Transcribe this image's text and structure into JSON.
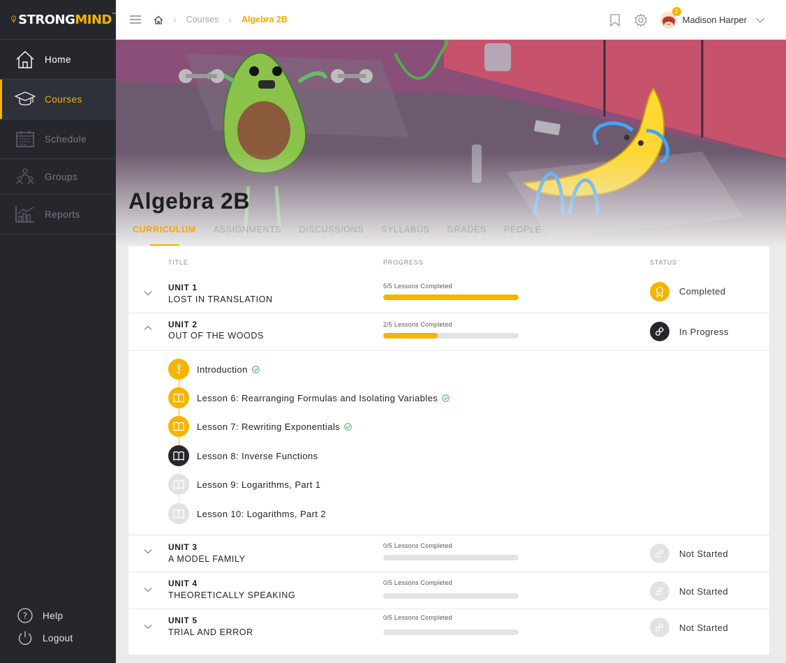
{
  "brand": {
    "strong": "STRONG",
    "mind": "MIND",
    "tm": "™"
  },
  "sidebar": {
    "items": [
      {
        "label": "Home",
        "icon": "home-icon"
      },
      {
        "label": "Courses",
        "icon": "graduation-cap-icon"
      },
      {
        "label": "Schedule",
        "icon": "calendar-icon"
      },
      {
        "label": "Groups",
        "icon": "groups-icon"
      },
      {
        "label": "Reports",
        "icon": "reports-icon"
      }
    ],
    "help": "Help",
    "logout": "Logout"
  },
  "breadcrumb": {
    "courses": "Courses",
    "current": "Algebra 2B"
  },
  "user": {
    "name": "Madison Harper",
    "notifications": "2"
  },
  "course": {
    "title": "Algebra 2B"
  },
  "tabs": [
    "CURRICULUM",
    "ASSIGNMENTS",
    "DISCUSSIONS",
    "SYLLABUS",
    "GRADES",
    "PEOPLE"
  ],
  "columns": {
    "title": "TITLE",
    "progress": "PROGRESS",
    "status": "STATUS"
  },
  "units": [
    {
      "number": "UNIT 1",
      "name": "LOST IN TRANSLATION",
      "progress_text": "5/5 Lessons Completed",
      "progress": 1.0,
      "status": "Completed",
      "expanded": false
    },
    {
      "number": "UNIT 2",
      "name": "OUT OF THE WOODS",
      "progress_text": "2/5 Lessons Completed",
      "progress": 0.4,
      "status": "In Progress",
      "expanded": true
    },
    {
      "number": "UNIT 3",
      "name": "A MODEL FAMILY",
      "progress_text": "0/5 Lessons Completed",
      "progress": 0,
      "status": "Not Started",
      "expanded": false
    },
    {
      "number": "UNIT 4",
      "name": "THEORETICALLY SPEAKING",
      "progress_text": "0/5 Lessons Completed",
      "progress": 0,
      "status": "Not Started",
      "expanded": false
    },
    {
      "number": "UNIT 5",
      "name": "TRIAL AND ERROR",
      "progress_text": "0/5 Lessons Completed",
      "progress": 0,
      "status": "Not Started",
      "expanded": false
    }
  ],
  "lessons": [
    {
      "title": "Introduction",
      "state": "completed"
    },
    {
      "title": "Lesson 6: Rearranging Formulas and Isolating Variables",
      "state": "completed"
    },
    {
      "title": "Lesson 7: Rewriting Exponentials",
      "state": "completed"
    },
    {
      "title": "Lesson 8: Inverse Functions",
      "state": "current"
    },
    {
      "title": "Lesson 9: Logarithms, Part 1",
      "state": "locked"
    },
    {
      "title": "Lesson 10: Logarithms, Part 2",
      "state": "locked"
    }
  ],
  "colors": {
    "accent": "#f5b400",
    "sidebar": "#25272d",
    "dark": "#24262b",
    "muted": "#e2e2e2"
  }
}
